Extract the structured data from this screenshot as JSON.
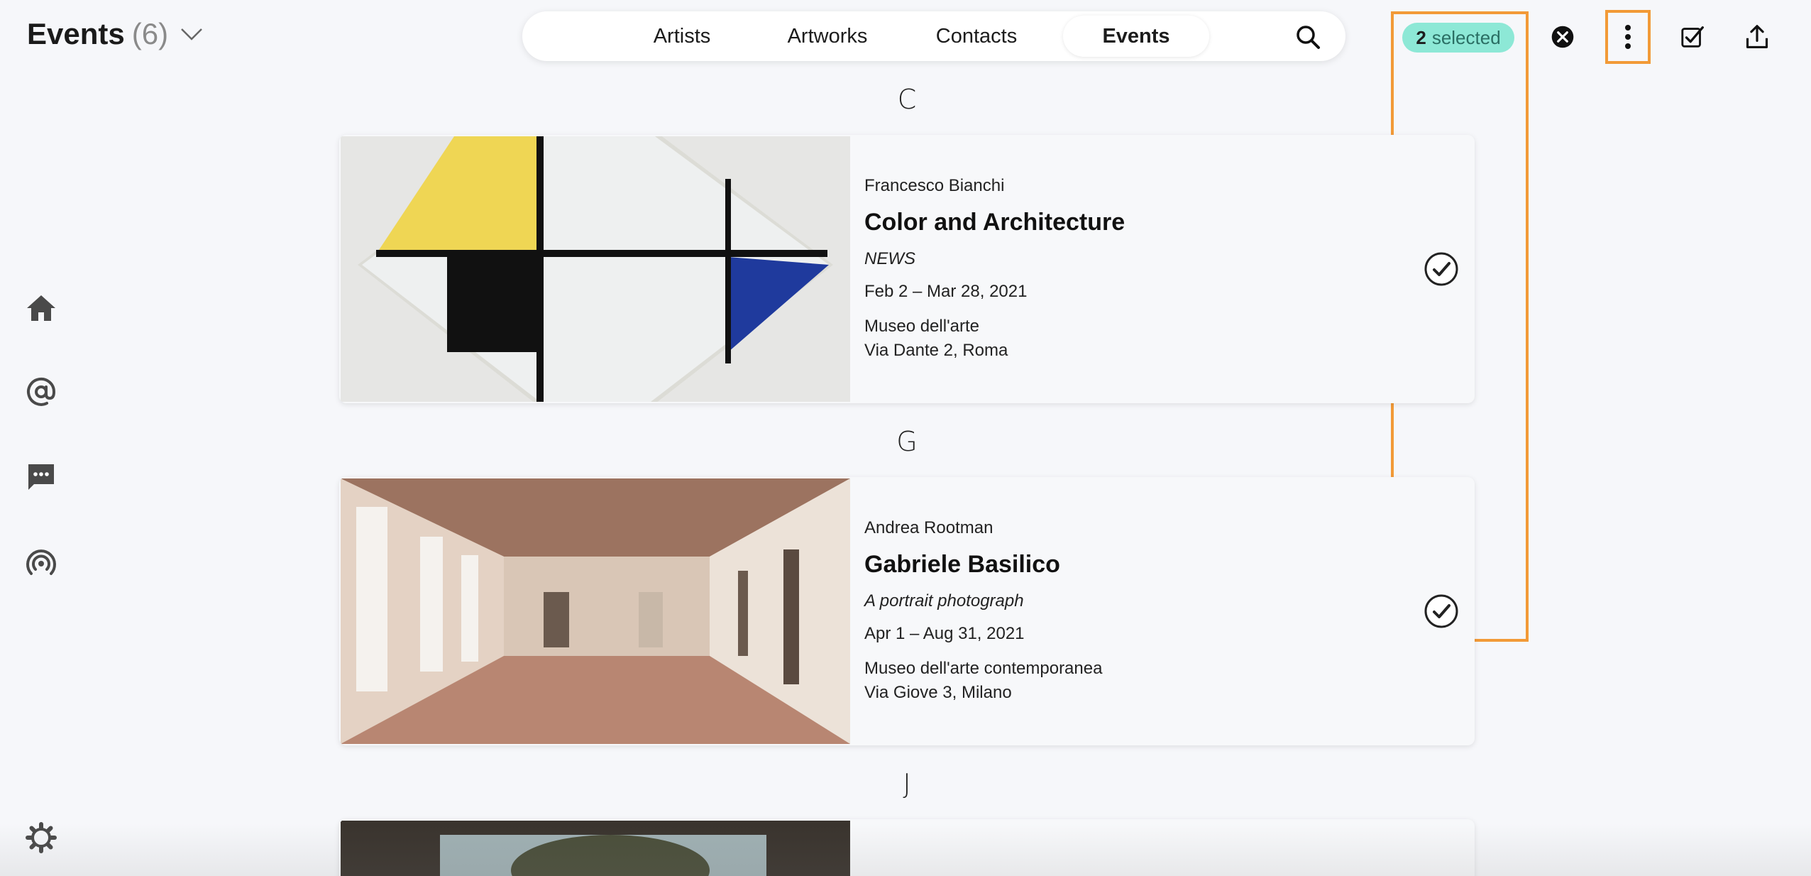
{
  "header": {
    "title": "Events",
    "count": "(6)"
  },
  "nav": {
    "tabs": [
      {
        "label": "Artists"
      },
      {
        "label": "Artworks"
      },
      {
        "label": "Contacts"
      },
      {
        "label": "Events",
        "active": true
      }
    ]
  },
  "selection": {
    "count": "2",
    "label": "selected"
  },
  "colors": {
    "accent_highlight": "#f29a37",
    "selected_pill": "#8de8d6",
    "background": "#f6f7fa"
  },
  "sidebar": {
    "icons": [
      "home-icon",
      "at-icon",
      "chat-icon",
      "broadcast-icon",
      "settings-icon"
    ]
  },
  "events": [
    {
      "letter": "C",
      "artist": "Francesco Bianchi",
      "title": "Color and Architecture",
      "subtitle": "NEWS",
      "dates": "Feb 2 – Mar 28, 2021",
      "venue": "Museo dell'arte",
      "address": "Via Dante 2, Roma",
      "selected": true
    },
    {
      "letter": "G",
      "artist": "Andrea Rootman",
      "title": "Gabriele Basilico",
      "subtitle": "A portrait photograph",
      "dates": "Apr 1 – Aug 31, 2021",
      "venue": "Museo dell'arte contemporanea",
      "address": "Via Giove 3, Milano",
      "selected": true
    },
    {
      "letter": "J"
    }
  ]
}
